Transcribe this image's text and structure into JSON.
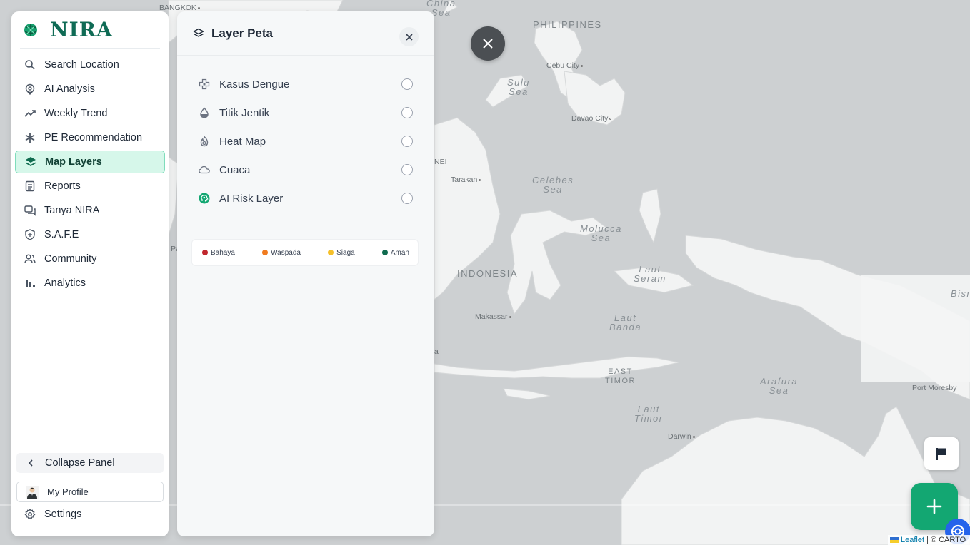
{
  "brand": {
    "name": "NIRA"
  },
  "sidebar": {
    "items": [
      {
        "label": "Search Location",
        "icon": "search-icon"
      },
      {
        "label": "AI Analysis",
        "icon": "ai-pin-icon"
      },
      {
        "label": "Weekly Trend",
        "icon": "trend-icon"
      },
      {
        "label": "PE Recommendation",
        "icon": "asterisk-icon"
      },
      {
        "label": "Map Layers",
        "icon": "layers-icon",
        "active": true
      },
      {
        "label": "Reports",
        "icon": "document-icon"
      },
      {
        "label": "Tanya NIRA",
        "icon": "chat-icon"
      },
      {
        "label": "S.A.F.E",
        "icon": "shield-icon"
      },
      {
        "label": "Community",
        "icon": "users-icon"
      },
      {
        "label": "Analytics",
        "icon": "bar-chart-icon"
      }
    ],
    "collapse_label": "Collapse Panel",
    "profile_label": "My Profile",
    "settings_label": "Settings"
  },
  "layer_panel": {
    "title": "Layer Peta",
    "layers": [
      {
        "label": "Kasus Dengue",
        "icon": "medical-cross-icon",
        "checked": false
      },
      {
        "label": "Titik Jentik",
        "icon": "droplet-icon",
        "checked": false
      },
      {
        "label": "Heat Map",
        "icon": "flame-icon",
        "checked": false
      },
      {
        "label": "Cuaca",
        "icon": "cloud-icon",
        "checked": false
      },
      {
        "label": "AI Risk Layer",
        "icon": "ai-brain-icon",
        "checked": false
      }
    ],
    "legend": [
      {
        "label": "Bahaya",
        "color": "#c0262d"
      },
      {
        "label": "Waspada",
        "color": "#f07b1f"
      },
      {
        "label": "Siaga",
        "color": "#f5c02a"
      },
      {
        "label": "Aman",
        "color": "#0f6b4f"
      }
    ]
  },
  "map": {
    "labels": {
      "bangkok": "BANGKOK",
      "china_sea": "China\nSea",
      "philippines": "PHILIPPINES",
      "cebu": "Cebu City",
      "sulu": "Sulu\nSea",
      "davao": "Davao City",
      "nei": "NEI",
      "tarakan": "Tarakan",
      "celebes": "Celebes\nSea",
      "molucca": "Molucca\nSea",
      "indonesia": "INDONESIA",
      "seram": "Laut\nSeram",
      "bisr": "Bisr",
      "makassar": "Makassar",
      "banda": "Laut\nBanda",
      "east_timor": "EAST\nTIMOR",
      "arafura": "Arafura\nSea",
      "port_moresby": "Port Moresby",
      "timor_sea": "Laut\nTimor",
      "darwin": "Darwin",
      "pa": "Pa",
      "a": "a"
    },
    "colors": {
      "water": "#cdd0d2",
      "land": "#f2f3f3",
      "border": "#c9c9c9"
    }
  },
  "attribution": {
    "leaflet": "Leaflet",
    "rest": "| © CARTO"
  },
  "accent": "#13a772"
}
